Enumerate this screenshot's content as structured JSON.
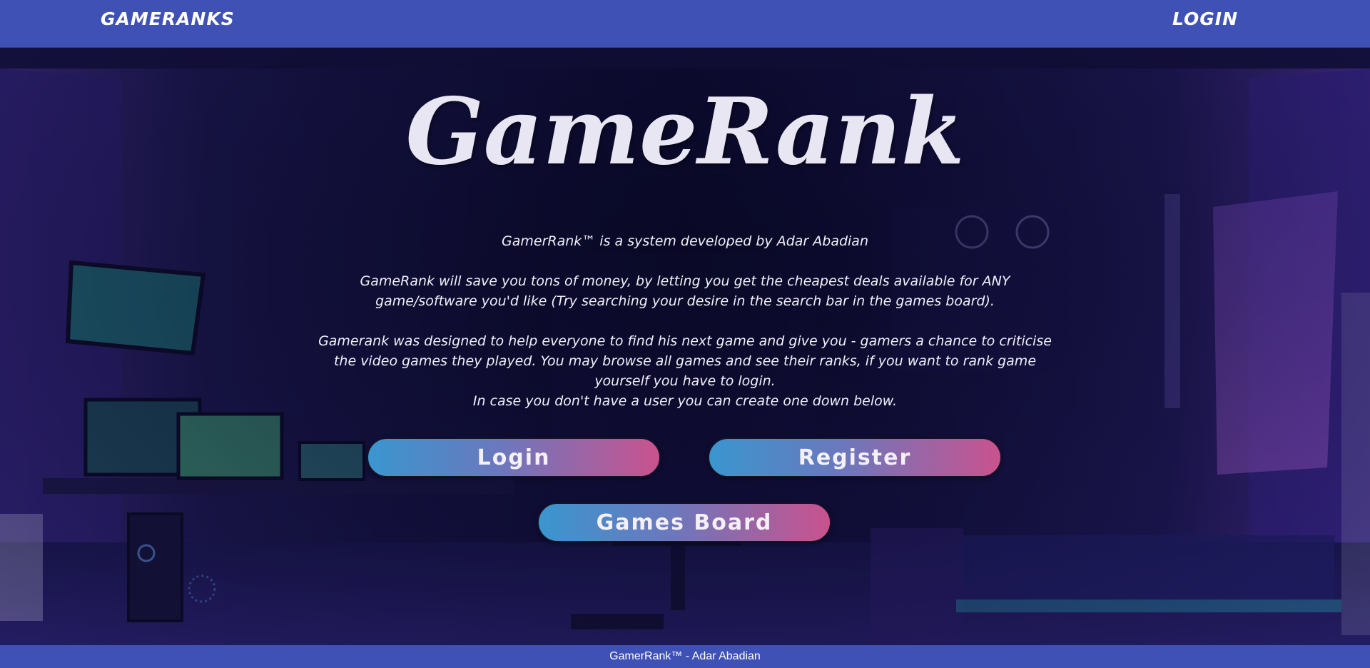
{
  "navbar": {
    "brand": "GAMERANKS",
    "login": "LOGIN"
  },
  "hero": {
    "title": "GameRank"
  },
  "intro": {
    "line1": "GamerRank™ is a system developed by Adar Abadian",
    "para2": "GameRank will save you tons of money, by letting you get the cheapest deals available for ANY game/software you'd like (Try searching your desire in the search bar in the games board).",
    "para3": "Gamerank was designed to help everyone to find his next game and give you - gamers a chance to criticise the video games they played. You may browse all games and see their ranks, if you want to rank game yourself you have to login.",
    "para4": "In case you don't have a user you can create one down below."
  },
  "buttons": {
    "login": "Login",
    "register": "Register",
    "games_board": "Games Board"
  },
  "footer": {
    "text": "GamerRank™ - Adar Abadian"
  },
  "colors": {
    "navbar": "#3f51b5",
    "button_gradient_start": "#3a96cf",
    "button_gradient_end": "#c9528e",
    "background": "#0d0b2e"
  },
  "icons": {
    "background": "gaming-room-illustration"
  }
}
